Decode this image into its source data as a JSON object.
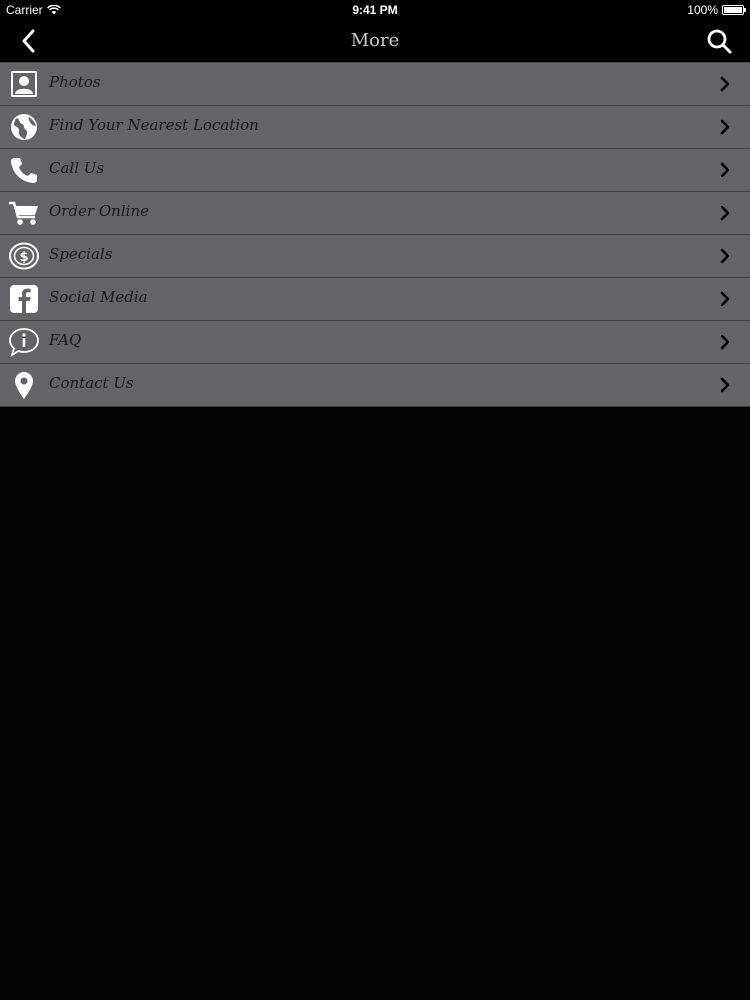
{
  "status_bar": {
    "carrier": "Carrier",
    "time": "9:41 PM",
    "battery": "100%",
    "battery_level": 1.0
  },
  "nav": {
    "title": "More",
    "back_icon": "chevron-left-icon",
    "search_icon": "search-icon"
  },
  "menu": {
    "items": [
      {
        "label": "Photos",
        "icon": "contact-card-icon"
      },
      {
        "label": "Find Your Nearest Location",
        "icon": "globe-icon"
      },
      {
        "label": "Call Us",
        "icon": "phone-icon"
      },
      {
        "label": "Order Online",
        "icon": "shopping-cart-icon"
      },
      {
        "label": "Specials",
        "icon": "dollar-coin-icon"
      },
      {
        "label": "Social Media",
        "icon": "facebook-icon"
      },
      {
        "label": "FAQ",
        "icon": "info-bubble-icon"
      },
      {
        "label": "Contact Us",
        "icon": "map-pin-icon"
      }
    ]
  },
  "colors": {
    "background": "#040306",
    "bar": "#000000",
    "row": "#646368",
    "row_divider": "#3e3d41",
    "label": "#1b1b1e",
    "icon": "#ffffff",
    "title": "#c8c8c8"
  }
}
